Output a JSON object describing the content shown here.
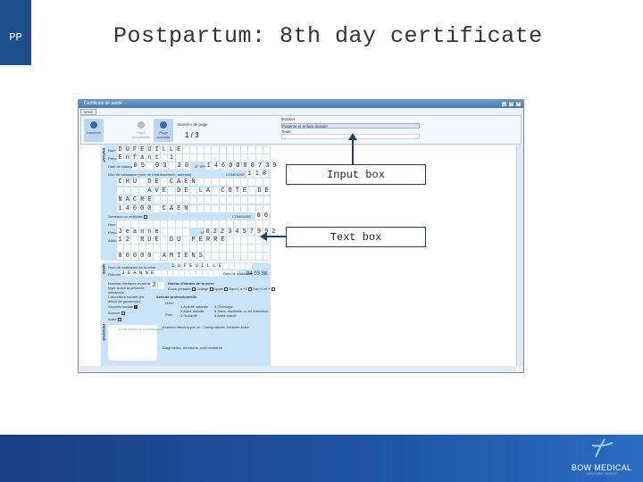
{
  "slide": {
    "tag": "PP",
    "title": "Postpartum: 8th day certificate"
  },
  "window": {
    "title": "Certificats de santé",
    "tab": "SPMC",
    "toolbar": {
      "print": "Imprimer",
      "prev": "Page précédente",
      "next": "Page suivante",
      "page_label": "Numéro de page",
      "page_value": "1 / 3",
      "dossier_label": "Dossier",
      "dossier_value": "Patiente et enfant dossier",
      "texte_label": "Texte",
      "texte_value": ""
    }
  },
  "form": {
    "side1": "ENFANT",
    "side2": "MÈRE",
    "side3": "RÉSERVÉ",
    "rows": [
      {
        "label": "Nom",
        "value": "DUFEUILLE"
      },
      {
        "label": "Prénom",
        "value": "Enfant 1"
      },
      {
        "label": "Date de naissance",
        "value": "05 03 20"
      },
      {
        "label": "N° IPP",
        "value": "1460000739"
      },
      {
        "label": "Lieu de naissance (nom de l'établissement, adresse)",
        "value": ""
      },
      {
        "label": "COMMUNE",
        "value": "118"
      },
      {
        "label": "",
        "value": "CHU DE CAEN"
      },
      {
        "label": "",
        "value": "    AVE DE LA COTE DE"
      },
      {
        "label": "",
        "value": "NACRE"
      },
      {
        "label": "",
        "value": "14000 CAEN"
      },
      {
        "label": "Jumeaux ou multiples",
        "value": ""
      },
      {
        "label": "COMMUNE",
        "value": "00"
      },
      {
        "label": "Nom",
        "value": ""
      },
      {
        "label": "Prénom",
        "value": "Jeanne"
      },
      {
        "label": "N°",
        "value": "0223457992"
      },
      {
        "label": "Adresse",
        "value": "12 RUE DU PERRE"
      },
      {
        "label": "",
        "value": ""
      },
      {
        "label": "",
        "value": "80000 AMIENS"
      }
    ],
    "mother": {
      "name_label": "Nom de naissance de la mère",
      "name": "DUFEUILLE",
      "first_label": "Prénom",
      "first": "JEANNE",
      "dob_label": "Date de naissance",
      "dob": [
        "04",
        "03",
        "58"
      ],
      "children_label": "Nombre d'enfants vivant au foyer avant la présente naissance",
      "children": "2",
      "study_label": "Niveau d'études de la mère",
      "study_opts": [
        "École primaire",
        "Collège",
        "Lycée",
        "Bac+1 à +2",
        "Bac+3 et +"
      ],
      "cover_label": "Couverture sociale (en début de grossesse)",
      "cover_opts": [
        "Sécurité sociale",
        "Aucune",
        "Autre"
      ],
      "activity_label": "Activité professionnelle",
      "activity_mere": "Mère",
      "activity_pere": "Père",
      "activity_opts": [
        "1 Activité salariée",
        "2 Autre activité",
        "3 Scolarité",
        "4 Chômage",
        "5 Sans, étudiante ou en formation",
        "6 Autre inactif"
      ],
      "exam_label": "Examen effectué par un : Omnipraticien  Pédiatre  Autre",
      "remarks": "Zone réservée à remarques",
      "decisions": "Diagnostics, décisions, commentaires"
    }
  },
  "callouts": {
    "input": "Input box",
    "text": "Text box"
  },
  "footer": {
    "logo": "BOW MEDICAL",
    "tagline": "DESIGNING INSIGHT"
  },
  "colors": {
    "slide_blue": "#1f4e8c",
    "form_blue": "#c9e4f8"
  }
}
